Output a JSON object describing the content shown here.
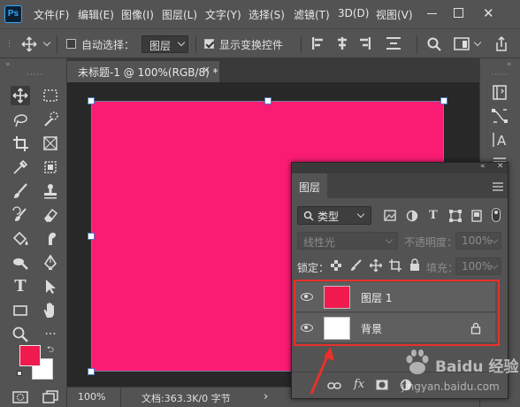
{
  "app": {
    "logo": "Ps"
  },
  "menu": [
    "文件(F)",
    "编辑(E)",
    "图像(I)",
    "图层(L)",
    "文字(Y)",
    "选择(S)",
    "滤镜(T)",
    "3D(D)",
    "视图(V)"
  ],
  "options_bar": {
    "auto_select_label": "自动选择：",
    "auto_select_checked": false,
    "auto_select_target": "图层",
    "show_transform_label": "显示变换控件",
    "show_transform_checked": true
  },
  "document": {
    "tab_title": "未标题-1 @ 100%(RGB/8) *",
    "tab_close": "×",
    "canvas_color": "#fa1c73",
    "zoom": "100%",
    "status": "文档:363.3K/0 字节",
    "status_arrow": "›"
  },
  "layers_panel": {
    "tab": "图层",
    "filter_kind": "类型",
    "blend_mode": "线性光",
    "opacity_label": "不透明度：",
    "opacity_value": "100%",
    "lock_label": "锁定：",
    "fill_label": "填充：",
    "fill_value": "100%",
    "layers": [
      {
        "name": "图层 1",
        "color": "#f01a4e",
        "locked": false
      },
      {
        "name": "背景",
        "color": "#ffffff",
        "locked": true
      }
    ],
    "footer_fx": "fx"
  },
  "colors": {
    "foreground": "#f01a4e",
    "background": "#ffffff",
    "annotation": "#e8312a"
  },
  "watermark": {
    "brand": "Baidu 经验",
    "url": "jingyan.baidu.com"
  }
}
